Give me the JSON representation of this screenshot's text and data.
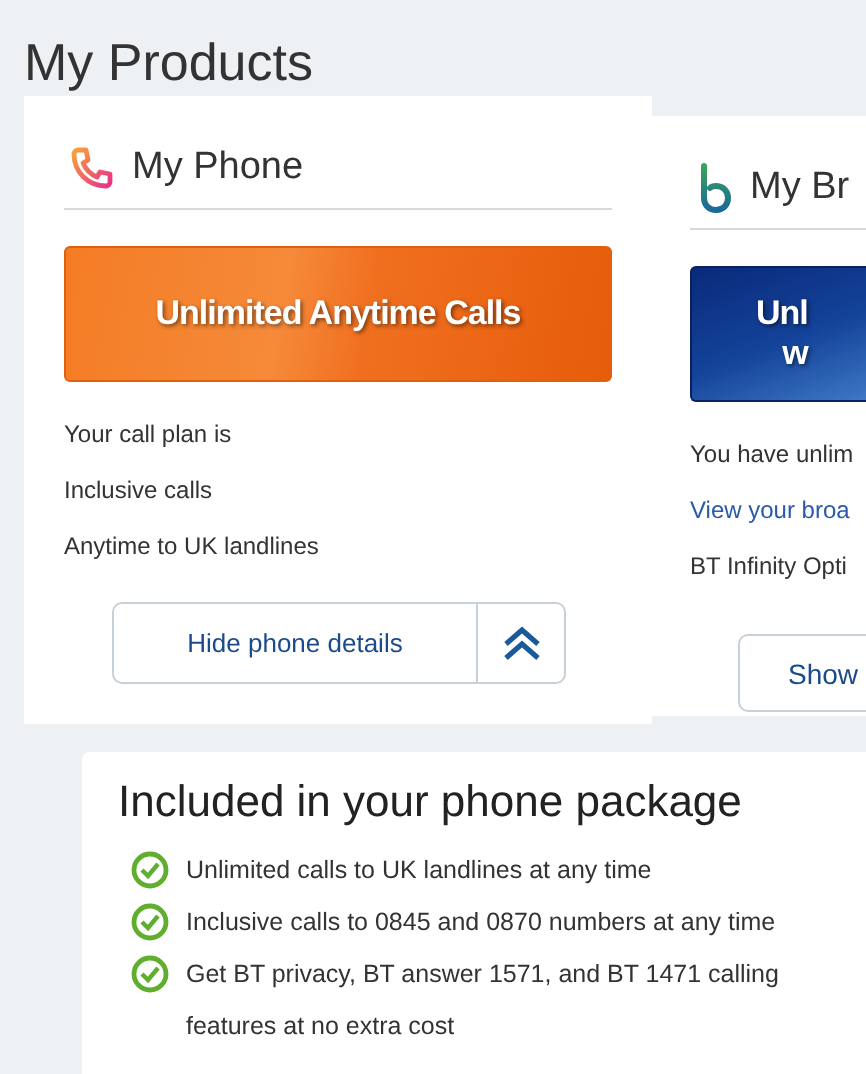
{
  "page_title": "My Products",
  "phone_card": {
    "title": "My Phone",
    "banner": "Unlimited Anytime Calls",
    "details": [
      "Your call plan is",
      "Inclusive calls",
      "Anytime to UK landlines"
    ],
    "toggle_button": {
      "label": "Hide phone details",
      "expanded": true
    }
  },
  "broadband_card": {
    "title": "My Br",
    "banner_lines": [
      "Unl",
      "w"
    ],
    "details": [
      {
        "kind": "text",
        "text": "You have unlim"
      },
      {
        "kind": "link",
        "text": "View your broa"
      },
      {
        "kind": "text",
        "text": "BT Infinity Opti"
      }
    ],
    "toggle_button": {
      "label": "Show"
    }
  },
  "package": {
    "title": "Included in your phone package",
    "items": [
      {
        "text": "Unlimited calls to UK landlines at any time",
        "included": true
      },
      {
        "text": "Inclusive calls to 0845 and 0870 numbers at any time",
        "included": true
      },
      {
        "text": "Get BT privacy, BT answer 1571, and BT 1471 calling features at no extra cost",
        "included": true
      }
    ]
  }
}
